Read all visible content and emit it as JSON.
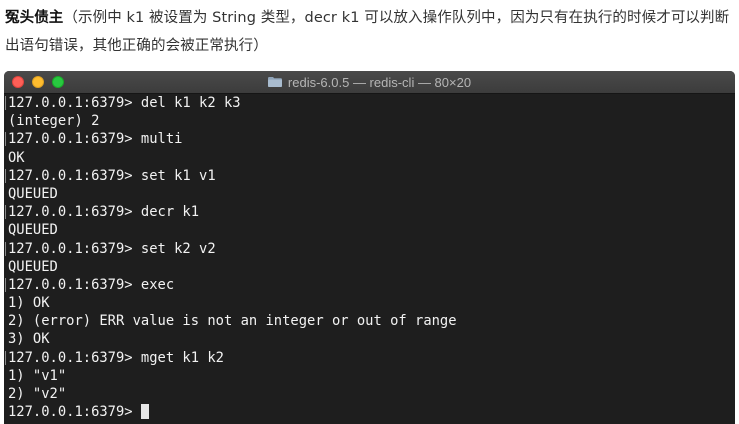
{
  "description": {
    "lead": "冤头债主",
    "text": "（示例中 k1 被设置为 String 类型，decr k1 可以放入操作队列中，因为只有在执行的时候才可以判断出语句错误，其他正确的会被正常执行）"
  },
  "window": {
    "title": "redis-6.0.5 — redis-cli — 80×20",
    "title_icon": "folder-icon",
    "buttons": [
      "close",
      "minimize",
      "maximize"
    ]
  },
  "terminal": {
    "lines": [
      {
        "text": "127.0.0.1:6379> del k1 k2 k3",
        "prompt": true
      },
      {
        "text": "(integer) 2",
        "prompt": false
      },
      {
        "text": "127.0.0.1:6379> multi",
        "prompt": true
      },
      {
        "text": "OK",
        "prompt": false
      },
      {
        "text": "127.0.0.1:6379> set k1 v1",
        "prompt": true
      },
      {
        "text": "QUEUED",
        "prompt": false
      },
      {
        "text": "127.0.0.1:6379> decr k1",
        "prompt": true
      },
      {
        "text": "QUEUED",
        "prompt": false
      },
      {
        "text": "127.0.0.1:6379> set k2 v2",
        "prompt": true
      },
      {
        "text": "QUEUED",
        "prompt": false
      },
      {
        "text": "127.0.0.1:6379> exec",
        "prompt": true
      },
      {
        "text": "1) OK",
        "prompt": false
      },
      {
        "text": "2) (error) ERR value is not an integer or out of range",
        "prompt": false
      },
      {
        "text": "3) OK",
        "prompt": false
      },
      {
        "text": "127.0.0.1:6379> mget k1 k2",
        "prompt": true
      },
      {
        "text": "1) \"v1\"",
        "prompt": false
      },
      {
        "text": "2) \"v2\"",
        "prompt": false
      }
    ],
    "current_prompt": "127.0.0.1:6379> "
  },
  "colors": {
    "terminal_bg": "#1e1e1e",
    "terminal_fg": "#f2f2f2",
    "close": "#fe5f57",
    "minimize": "#febc2e",
    "maximize": "#28c840"
  }
}
